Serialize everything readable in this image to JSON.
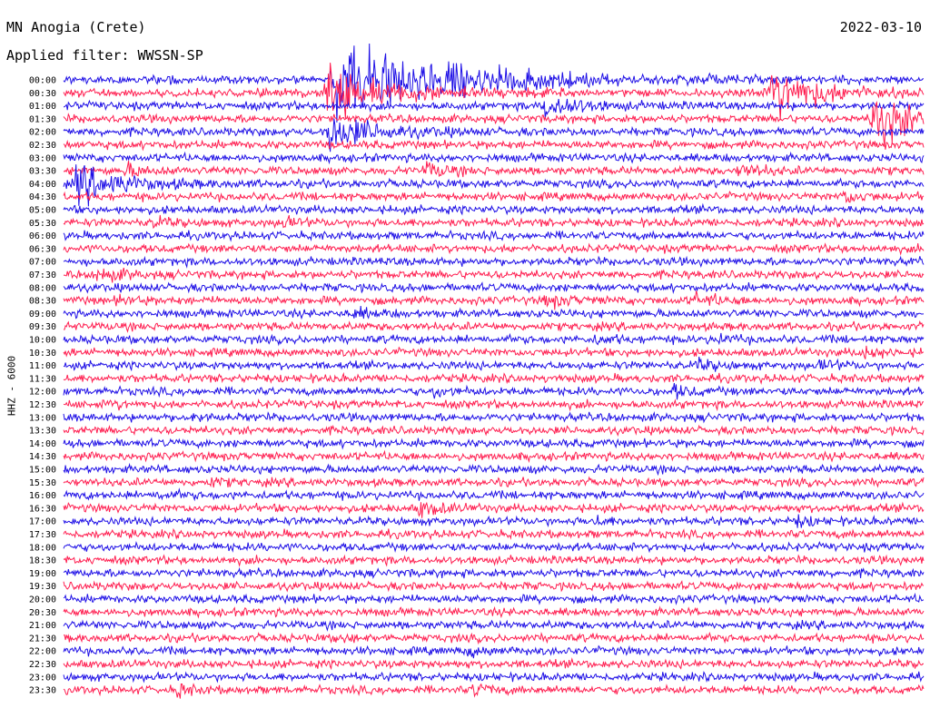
{
  "header": {
    "station": "MN Anogia (Crete)",
    "filter": "Applied filter: WWSSN-SP",
    "date": "2022-03-10",
    "channel_label": "HHZ - 6000"
  },
  "colors": {
    "odd_rows": "#1e0fe6",
    "even_rows": "#ff1e50"
  },
  "chart_data": {
    "type": "line",
    "title": "MN Anogia (Crete)",
    "subtitle": "Applied filter: WWSSN-SP",
    "date": "2022-03-10",
    "ylabel": "HHZ - 6000",
    "xlabel": "",
    "row_labels": [
      "00:00",
      "00:30",
      "01:00",
      "01:30",
      "02:00",
      "02:30",
      "03:00",
      "03:30",
      "04:00",
      "04:30",
      "05:00",
      "05:30",
      "06:00",
      "06:30",
      "07:00",
      "07:30",
      "08:00",
      "08:30",
      "09:00",
      "09:30",
      "10:00",
      "10:30",
      "11:00",
      "11:30",
      "12:00",
      "12:30",
      "13:00",
      "13:30",
      "14:00",
      "14:30",
      "15:00",
      "15:30",
      "16:00",
      "16:30",
      "17:00",
      "17:30",
      "18:00",
      "18:30",
      "19:00",
      "19:30",
      "20:00",
      "20:30",
      "21:00",
      "21:30",
      "22:00",
      "22:30",
      "23:00",
      "23:30"
    ],
    "row_minutes": 30,
    "events": [
      {
        "row": 0,
        "minute": 9.4,
        "amp": 9,
        "dur": 3.5
      },
      {
        "row": 1,
        "minute": 24.6,
        "amp": 6,
        "dur": 1.5
      },
      {
        "row": 1,
        "minute": 9.2,
        "amp": 5,
        "dur": 2
      },
      {
        "row": 2,
        "minute": 16.8,
        "amp": 3,
        "dur": 1
      },
      {
        "row": 3,
        "minute": 28.2,
        "amp": 6,
        "dur": 1.5
      },
      {
        "row": 4,
        "minute": 9.2,
        "amp": 4,
        "dur": 1.5
      },
      {
        "row": 7,
        "minute": 2.2,
        "amp": 1.3,
        "dur": 0.6
      },
      {
        "row": 7,
        "minute": 12.6,
        "amp": 1.5,
        "dur": 0.7
      },
      {
        "row": 7,
        "minute": 23.6,
        "amp": 1.4,
        "dur": 0.7
      },
      {
        "row": 8,
        "minute": 0.4,
        "amp": 4,
        "dur": 1.5
      },
      {
        "row": 9,
        "minute": 27.2,
        "amp": 1.3,
        "dur": 0.6
      },
      {
        "row": 11,
        "minute": 3.1,
        "amp": 0.9,
        "dur": 0.5
      },
      {
        "row": 11,
        "minute": 7.6,
        "amp": 1,
        "dur": 0.5
      },
      {
        "row": 15,
        "minute": 1.1,
        "amp": 1.6,
        "dur": 0.8
      },
      {
        "row": 17,
        "minute": 1.9,
        "amp": 1,
        "dur": 0.5
      },
      {
        "row": 17,
        "minute": 16.8,
        "amp": 1.2,
        "dur": 0.8
      },
      {
        "row": 17,
        "minute": 22.0,
        "amp": 1.2,
        "dur": 0.8
      },
      {
        "row": 18,
        "minute": 10.1,
        "amp": 1,
        "dur": 0.6
      },
      {
        "row": 20,
        "minute": 18.6,
        "amp": 0.9,
        "dur": 0.5
      },
      {
        "row": 20,
        "minute": 22.6,
        "amp": 1.1,
        "dur": 0.5
      },
      {
        "row": 21,
        "minute": 27.8,
        "amp": 1.2,
        "dur": 0.6
      },
      {
        "row": 22,
        "minute": 22.1,
        "amp": 1,
        "dur": 0.6
      },
      {
        "row": 22,
        "minute": 26.4,
        "amp": 1,
        "dur": 0.5
      },
      {
        "row": 24,
        "minute": 12.9,
        "amp": 1,
        "dur": 0.5
      },
      {
        "row": 24,
        "minute": 21.3,
        "amp": 1.1,
        "dur": 0.6
      },
      {
        "row": 25,
        "minute": 1.5,
        "amp": 0.8,
        "dur": 0.5
      },
      {
        "row": 26,
        "minute": 4.4,
        "amp": 0.8,
        "dur": 0.4
      },
      {
        "row": 31,
        "minute": 5.1,
        "amp": 0.7,
        "dur": 0.5
      },
      {
        "row": 32,
        "minute": 3.3,
        "amp": 0.8,
        "dur": 0.5
      },
      {
        "row": 33,
        "minute": 12.4,
        "amp": 1.6,
        "dur": 0.7
      },
      {
        "row": 34,
        "minute": 18.5,
        "amp": 0.9,
        "dur": 0.5
      },
      {
        "row": 34,
        "minute": 25.6,
        "amp": 0.9,
        "dur": 0.5
      },
      {
        "row": 43,
        "minute": 9.6,
        "amp": 0.7,
        "dur": 0.4
      },
      {
        "row": 44,
        "minute": 14.1,
        "amp": 1.1,
        "dur": 0.5
      },
      {
        "row": 47,
        "minute": 3.9,
        "amp": 1.4,
        "dur": 0.5
      },
      {
        "row": 47,
        "minute": 14.3,
        "amp": 1.4,
        "dur": 0.5
      }
    ]
  }
}
